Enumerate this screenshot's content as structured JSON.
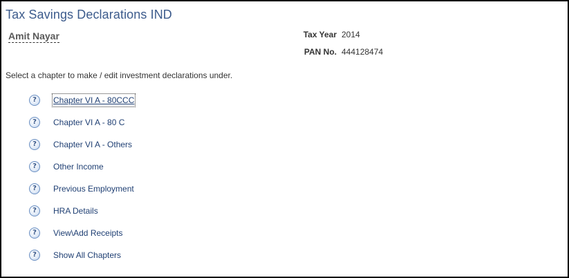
{
  "header": {
    "title": "Tax Savings Declarations IND",
    "employee_name": "Amit Nayar"
  },
  "info": {
    "tax_year_label": "Tax Year",
    "tax_year_value": "2014",
    "pan_label": "PAN No.",
    "pan_value": "444128474"
  },
  "instruction": "Select a chapter to make / edit investment declarations under.",
  "chapters": [
    {
      "label": "Chapter VI A - 80CCC",
      "icon": "help-icon"
    },
    {
      "label": "Chapter VI A - 80 C",
      "icon": "help-icon"
    },
    {
      "label": "Chapter VI A - Others",
      "icon": "help-icon"
    },
    {
      "label": "Other Income",
      "icon": "help-icon"
    },
    {
      "label": "Previous Employment",
      "icon": "help-icon"
    },
    {
      "label": "HRA Details",
      "icon": "help-icon"
    },
    {
      "label": "View\\Add Receipts",
      "icon": "help-icon"
    },
    {
      "label": "Show All Chapters",
      "icon": "help-icon"
    }
  ],
  "help_glyph": "?",
  "colors": {
    "title": "#3c5b8c",
    "link": "#1f3f73",
    "frame_border": "#000000"
  }
}
